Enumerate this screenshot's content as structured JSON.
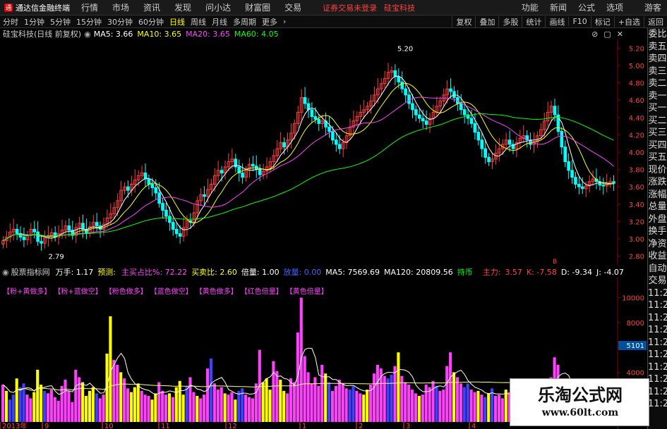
{
  "app": {
    "title": "通达信金融终端",
    "menu": [
      "行情",
      "市场",
      "资讯",
      "发现",
      "问小达",
      "财富圈",
      "交易"
    ],
    "notice_left": "证券交易未登录",
    "notice_right": "硅宝科技",
    "right_menu": [
      "功能",
      "新闻",
      "公式",
      "选项"
    ],
    "guest": "游客"
  },
  "toolbar": {
    "periods": [
      "分时",
      "1分钟",
      "5分钟",
      "15分钟",
      "30分钟",
      "60分钟",
      "日线",
      "周线",
      "月线",
      "多周期",
      "更多"
    ],
    "active_period": "日线",
    "tools": [
      "复权",
      "叠加",
      "多股",
      "统计",
      "画线",
      "F10",
      "标记",
      "+自选",
      "返回"
    ]
  },
  "chart_info": {
    "stock": "硅宝科技(日线 前复权)",
    "ma5": "MA5: 3.66",
    "ma10": "MA10: 3.65",
    "ma20": "MA20: 3.65",
    "ma60": "MA60: 4.05",
    "high": "5.20",
    "low": "2.79",
    "marker": "B"
  },
  "price_axis": [
    "5.20",
    "5.00",
    "4.80",
    "4.60",
    "4.40",
    "4.20",
    "4.00",
    "3.80",
    "3.60",
    "3.40",
    "3.20",
    "3.00",
    "2.80"
  ],
  "right_panel": [
    "委比",
    "卖五",
    "卖四",
    "卖三",
    "卖二",
    "卖一",
    "买一",
    "买二",
    "买三",
    "买四",
    "买五",
    "现价",
    "涨跌",
    "涨幅",
    "总量",
    "外盘",
    "换手",
    "净资",
    "收益",
    "自动",
    "交易",
    "11:2",
    "11:2",
    "11:2",
    "11:2",
    "11:2",
    "11:2",
    "11:2",
    "11:2",
    "11:2",
    "11:2"
  ],
  "lower": {
    "title": "股票指标网",
    "wanshou": "万手: 1.17",
    "yuce": "预测:",
    "zhuli": "主买占比%: 72.22",
    "maimai": "买卖比: 2.60",
    "beiliang": "倍量: 1.00",
    "fangliang": "放量: 0.00",
    "vma5": "MA5: 7569.69",
    "ma120": "MA120: 20809.56",
    "chibi": "持币",
    "zhuli2": "主力:",
    "v357": "3.57",
    "k": "K: -7.58",
    "d": "D: -9.34",
    "j": "J: -4.07",
    "axis": [
      "10000",
      "8000",
      "6000",
      "4000"
    ],
    "badge": "5101",
    "strategies": [
      "【粉+黄做多】",
      "【粉+蓝做空】",
      "【粉色做多】",
      "【蓝色做空】",
      "【黄色做多】",
      "【红色倍量】",
      "【黄色倍量】"
    ]
  },
  "date_axis": [
    "2013年",
    "9",
    "10",
    "11",
    "12",
    "1",
    "2",
    "3",
    "4"
  ],
  "watermark": {
    "name": "乐淘公式网",
    "url": "www.60lt.com"
  },
  "colors": {
    "up": "#ff3c3c",
    "down": "#00ffff",
    "ma5": "#ffffff",
    "ma10": "#ffff00",
    "ma20": "#ff40ff",
    "ma60": "#00ff00"
  },
  "chart_data": {
    "type": "candlestick",
    "ylim": [
      2.7,
      5.3
    ],
    "closes": [
      2.98,
      3.02,
      3.08,
      3.11,
      3.06,
      3.02,
      2.99,
      3.04,
      3.11,
      3.08,
      2.97,
      2.95,
      3.01,
      3.04,
      3.07,
      3.02,
      3.06,
      3.1,
      3.15,
      3.1,
      3.04,
      3.13,
      3.18,
      3.11,
      3.07,
      3.14,
      3.19,
      3.15,
      3.11,
      3.17,
      3.24,
      3.29,
      3.36,
      3.44,
      3.56,
      3.6,
      3.56,
      3.63,
      3.68,
      3.73,
      3.76,
      3.69,
      3.63,
      3.59,
      3.53,
      3.41,
      3.33,
      3.26,
      3.19,
      3.11,
      3.06,
      3.03,
      3.13,
      3.21,
      3.19,
      3.3,
      3.44,
      3.51,
      3.49,
      3.57,
      3.63,
      3.73,
      3.79,
      3.76,
      3.83,
      3.89,
      3.92,
      3.83,
      3.76,
      3.71,
      3.79,
      3.86,
      3.84,
      3.8,
      3.74,
      3.78,
      3.83,
      3.89,
      3.96,
      4.04,
      4.11,
      4.06,
      4.14,
      4.22,
      4.33,
      4.46,
      4.63,
      4.56,
      4.49,
      4.41,
      4.38,
      4.33,
      4.36,
      4.29,
      4.24,
      4.14,
      4.09,
      4.04,
      4.11,
      4.19,
      4.29,
      4.36,
      4.41,
      4.46,
      4.49,
      4.53,
      4.59,
      4.66,
      4.73,
      4.79,
      4.85,
      4.92,
      4.94,
      4.87,
      4.81,
      4.73,
      4.66,
      4.56,
      4.49,
      4.43,
      4.39,
      4.36,
      4.32,
      4.39,
      4.46,
      4.53,
      4.59,
      4.66,
      4.73,
      4.7,
      4.63,
      4.56,
      4.49,
      4.43,
      4.39,
      4.33,
      4.23,
      4.14,
      4.04,
      3.94,
      3.89,
      3.92,
      3.99,
      4.04,
      4.09,
      4.14,
      4.09,
      4.04,
      4.11,
      4.16,
      4.19,
      4.14,
      4.09,
      4.12,
      4.19,
      4.26,
      4.36,
      4.46,
      4.53,
      4.43,
      4.24,
      4.06,
      3.89,
      3.79,
      3.71,
      3.63,
      3.6,
      3.58,
      3.61,
      3.66,
      3.69,
      3.66,
      3.62,
      3.61,
      3.64,
      3.66,
      3.64
    ],
    "opens": [
      2.94,
      2.98,
      3.02,
      3.08,
      3.11,
      3.06,
      3.02,
      2.99,
      3.04,
      3.11,
      3.08,
      2.97,
      2.95,
      3.01,
      3.04,
      3.07,
      3.02,
      3.06,
      3.1,
      3.15,
      3.1,
      3.04,
      3.13,
      3.18,
      3.11,
      3.07,
      3.14,
      3.19,
      3.15,
      3.11,
      3.17,
      3.24,
      3.29,
      3.36,
      3.44,
      3.56,
      3.6,
      3.56,
      3.63,
      3.68,
      3.73,
      3.76,
      3.69,
      3.63,
      3.59,
      3.53,
      3.41,
      3.33,
      3.26,
      3.19,
      3.11,
      3.06,
      3.03,
      3.13,
      3.21,
      3.19,
      3.3,
      3.44,
      3.51,
      3.49,
      3.57,
      3.63,
      3.73,
      3.79,
      3.76,
      3.83,
      3.89,
      3.92,
      3.83,
      3.76,
      3.71,
      3.79,
      3.86,
      3.84,
      3.8,
      3.74,
      3.78,
      3.83,
      3.89,
      3.96,
      4.04,
      4.11,
      4.06,
      4.14,
      4.22,
      4.33,
      4.46,
      4.63,
      4.56,
      4.49,
      4.41,
      4.38,
      4.33,
      4.36,
      4.29,
      4.24,
      4.14,
      4.09,
      4.04,
      4.11,
      4.19,
      4.29,
      4.36,
      4.41,
      4.46,
      4.49,
      4.53,
      4.59,
      4.66,
      4.73,
      4.79,
      4.85,
      4.92,
      4.94,
      4.87,
      4.81,
      4.73,
      4.66,
      4.56,
      4.49,
      4.43,
      4.39,
      4.36,
      4.32,
      4.39,
      4.46,
      4.53,
      4.59,
      4.66,
      4.73,
      4.7,
      4.63,
      4.56,
      4.49,
      4.43,
      4.39,
      4.33,
      4.23,
      4.14,
      4.04,
      3.94,
      3.89,
      3.92,
      3.99,
      4.04,
      4.09,
      4.14,
      4.09,
      4.04,
      4.11,
      4.16,
      4.19,
      4.14,
      4.09,
      4.12,
      4.19,
      4.26,
      4.36,
      4.46,
      4.53,
      4.43,
      4.24,
      4.06,
      3.89,
      3.79,
      3.71,
      3.63,
      3.6,
      3.58,
      3.61,
      3.66,
      3.69,
      3.66,
      3.62,
      3.61,
      3.64,
      3.66
    ],
    "volumes": [
      3,
      2.5,
      1.8,
      2.2,
      3.5,
      2.8,
      3.1,
      2.2,
      1.9,
      2.4,
      4.2,
      3,
      2.5,
      2.3,
      2.6,
      2,
      1.7,
      2.9,
      3.4,
      2.5,
      1.6,
      4.2,
      3.6,
      3.2,
      2.1,
      2.5,
      2.8,
      2.3,
      1.9,
      2.2,
      5.5,
      8.5,
      5,
      4.6,
      4,
      3.5,
      2.7,
      2.4,
      2.8,
      3.1,
      2.5,
      2.2,
      2.1,
      1.8,
      2.3,
      3.2,
      2.5,
      2.2,
      2.3,
      2,
      2.8,
      3.3,
      2.2,
      2.9,
      3.6,
      2.4,
      2.1,
      1.9,
      2.2,
      4.3,
      5.1,
      3.1,
      2.6,
      2.8,
      2.3,
      2.2,
      2.4,
      1.8,
      2.5,
      2.7,
      2.2,
      2,
      1.9,
      3.1,
      5.8,
      3.2,
      3.5,
      2.6,
      4.9,
      4.1,
      3.4,
      2.5,
      2.3,
      3.5,
      3.2,
      7.2,
      10,
      5.3,
      4,
      3.1,
      3.6,
      2.9,
      4.6,
      3.9,
      3.2,
      2.5,
      2.9,
      3.4,
      3.1,
      2.7,
      2.6,
      2.9,
      2.5,
      2.3,
      2.2,
      2.6,
      3,
      3.9,
      4.6,
      4.3,
      3.7,
      3.5,
      3.8,
      4.5,
      5.6,
      3.7,
      3.2,
      3,
      2.6,
      2.3,
      2.1,
      2.2,
      3,
      2.8,
      3.3,
      2.9,
      2.5,
      2.6,
      4.5,
      5.6,
      4,
      3.6,
      3.1,
      2.8,
      3.1,
      2.6,
      2.4,
      2.5,
      2.2,
      2,
      2.3,
      2.7,
      2.1,
      2.2,
      1.9,
      2.6,
      2.4,
      2.1,
      1.8,
      1.6,
      2.2,
      2.5,
      1.9,
      1.6,
      1.4,
      1.6,
      2.1,
      2.7,
      3.6,
      5.2,
      4.6,
      3.2,
      3.1,
      2.6,
      2.4,
      2.2,
      2,
      1.7,
      1.8,
      2.1,
      1.9,
      1.6,
      1.5,
      1.7,
      2,
      1.8,
      1.6,
      1.9,
      2.2,
      2.5
    ]
  }
}
